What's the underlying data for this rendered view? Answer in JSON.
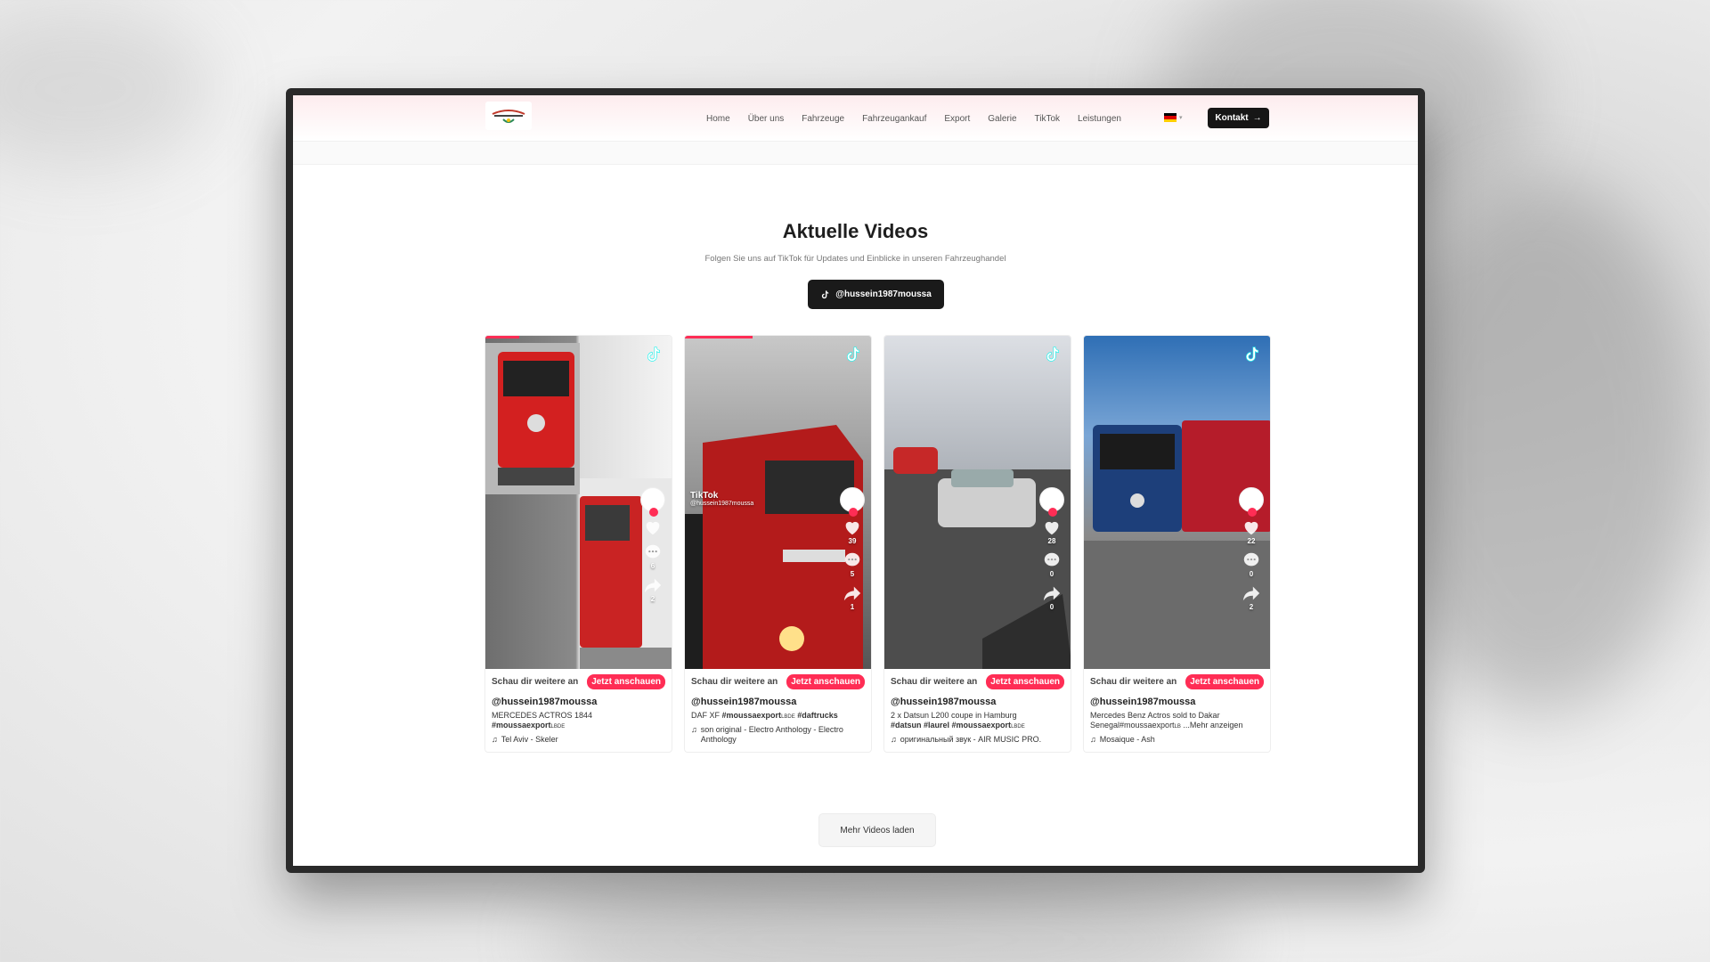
{
  "nav": {
    "items": [
      "Home",
      "Über uns",
      "Fahrzeuge",
      "Fahrzeugankauf",
      "Export",
      "Galerie",
      "TikTok",
      "Leistungen"
    ],
    "contact_label": "Kontakt",
    "language": "de",
    "logo_icon": "moussa-export-logo"
  },
  "section": {
    "title": "Aktuelle Videos",
    "subtitle": "Folgen Sie uns auf TikTok für Updates und Einblicke in unseren Fahrzeughandel",
    "tiktok_button": "@hussein1987moussa",
    "load_more": "Mehr Videos laden"
  },
  "videos": [
    {
      "cta_text": "Schau dir weitere an",
      "cta_button": "Jetzt anschauen",
      "handle": "@hussein1987moussa",
      "description": "MERCEDES ACTROS 1844",
      "tags": "#moussaexport",
      "suffix": "LBDE",
      "music": "Tel Aviv - Skeler",
      "likes": "",
      "comments": "6",
      "shares": "2",
      "progress": 0.18
    },
    {
      "cta_text": "Schau dir weitere an",
      "cta_button": "Jetzt anschauen",
      "handle": "@hussein1987moussa",
      "description": "DAF XF",
      "tags": "#moussaexport",
      "suffix": "LBDE",
      "tags2": "#daftrucks",
      "music": "son original - Electro Anthology - Electro Anthology",
      "likes": "39",
      "comments": "5",
      "shares": "1",
      "progress": 0.36,
      "watermark": "TikTok",
      "watermark_handle": "@hussein1987moussa"
    },
    {
      "cta_text": "Schau dir weitere an",
      "cta_button": "Jetzt anschauen",
      "handle": "@hussein1987moussa",
      "description": "2 x Datsun L200 coupe in Hamburg",
      "tags": "#datsun #laurel #moussaexport",
      "suffix": "LBDE",
      "music": "оригинальный звук - AIR MUSIC PRO.",
      "likes": "28",
      "comments": "0",
      "shares": "0",
      "progress": 0
    },
    {
      "cta_text": "Schau dir weitere an",
      "cta_button": "Jetzt anschauen",
      "handle": "@hussein1987moussa",
      "description": "Mercedes Benz Actros sold to Dakar Senegal#moussaexport",
      "tags": "",
      "suffix": "LB",
      "more": " ...Mehr anzeigen",
      "music": "Mosaique - Ash",
      "likes": "22",
      "comments": "0",
      "shares": "2",
      "progress": 0
    }
  ],
  "colors": {
    "accent": "#ff2d55",
    "button_dark": "#161616"
  }
}
